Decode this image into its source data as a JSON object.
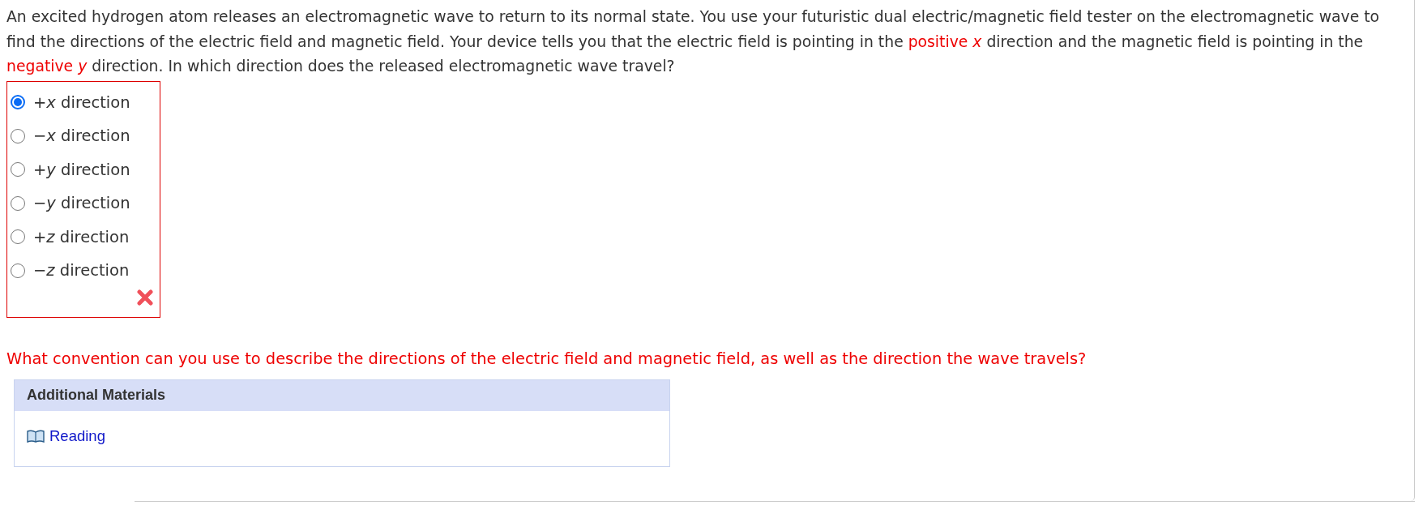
{
  "question": {
    "segments": [
      {
        "text": "An excited hydrogen atom releases an electromagnetic wave to return to its normal state. You use your futuristic dual electric/magnetic field tester on the electromagnetic wave to find the directions of the electric field and magnetic field. Your device tells you that the electric field is pointing in the ",
        "highlight": false
      },
      {
        "text": "positive *x*",
        "highlight": true
      },
      {
        "text": " direction and the magnetic field is pointing in the ",
        "highlight": false
      },
      {
        "text": "negative *y*",
        "highlight": true
      },
      {
        "text": " direction. In which direction does the released electromagnetic wave travel?",
        "highlight": false
      }
    ]
  },
  "answer": {
    "incorrect": true,
    "options": [
      {
        "label": "+*x* direction",
        "selected": true
      },
      {
        "label": "−*x* direction",
        "selected": false
      },
      {
        "label": "+*y* direction",
        "selected": false
      },
      {
        "label": "−*y* direction",
        "selected": false
      },
      {
        "label": "+*z* direction",
        "selected": false
      },
      {
        "label": "−*z* direction",
        "selected": false
      }
    ]
  },
  "feedback": "What convention can you use to describe the directions of the electric field and magnetic field, as well as the direction the wave travels?",
  "additional_materials": {
    "title": "Additional Materials",
    "links": [
      "Reading"
    ]
  }
}
